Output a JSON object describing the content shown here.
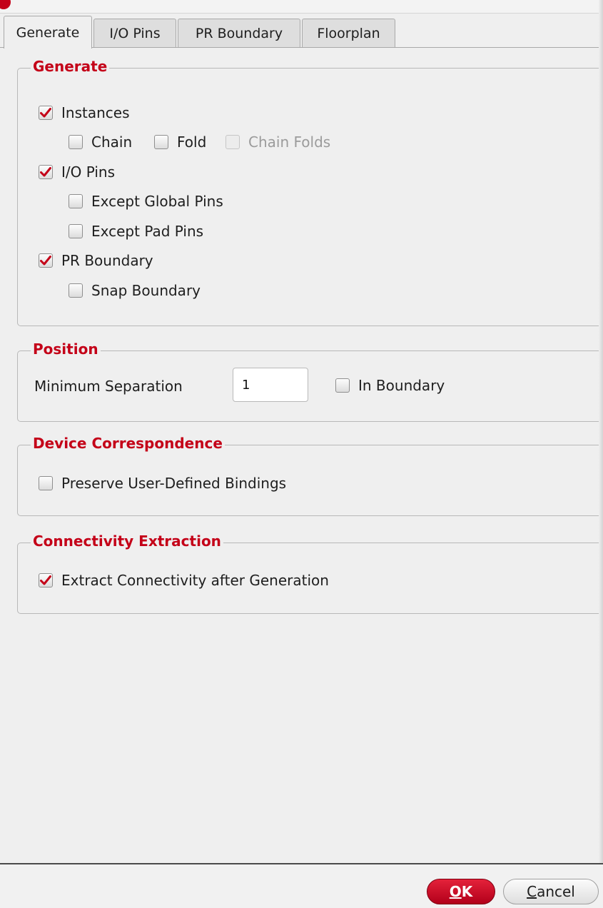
{
  "tabs": [
    {
      "label": "Generate",
      "active": true
    },
    {
      "label": "I/O Pins",
      "active": false
    },
    {
      "label": "PR Boundary",
      "active": false
    },
    {
      "label": "Floorplan",
      "active": false
    }
  ],
  "generate": {
    "title": "Generate",
    "instances": {
      "label": "Instances",
      "checked": true
    },
    "chain": {
      "label": "Chain",
      "checked": false
    },
    "fold": {
      "label": "Fold",
      "checked": false
    },
    "chain_folds": {
      "label": "Chain Folds",
      "checked": false,
      "disabled": true
    },
    "io_pins": {
      "label": "I/O Pins",
      "checked": true
    },
    "except_global_pins": {
      "label": "Except Global Pins",
      "checked": false
    },
    "except_pad_pins": {
      "label": "Except Pad Pins",
      "checked": false
    },
    "pr_boundary": {
      "label": "PR Boundary",
      "checked": true
    },
    "snap_boundary": {
      "label": "Snap Boundary",
      "checked": false
    }
  },
  "position": {
    "title": "Position",
    "min_sep_label": "Minimum Separation",
    "min_sep_value": "1",
    "in_boundary": {
      "label": "In Boundary",
      "checked": false
    }
  },
  "device_correspondence": {
    "title": "Device Correspondence",
    "preserve_bindings": {
      "label": "Preserve User-Defined Bindings",
      "checked": false
    }
  },
  "connectivity": {
    "title": "Connectivity Extraction",
    "extract": {
      "label": "Extract Connectivity after Generation",
      "checked": true
    }
  },
  "buttons": {
    "ok_mnemonic": "O",
    "ok_rest": "K",
    "cancel_mnemonic": "C",
    "cancel_rest": "ancel"
  },
  "colors": {
    "accent": "#c40018",
    "background": "#efefef"
  }
}
